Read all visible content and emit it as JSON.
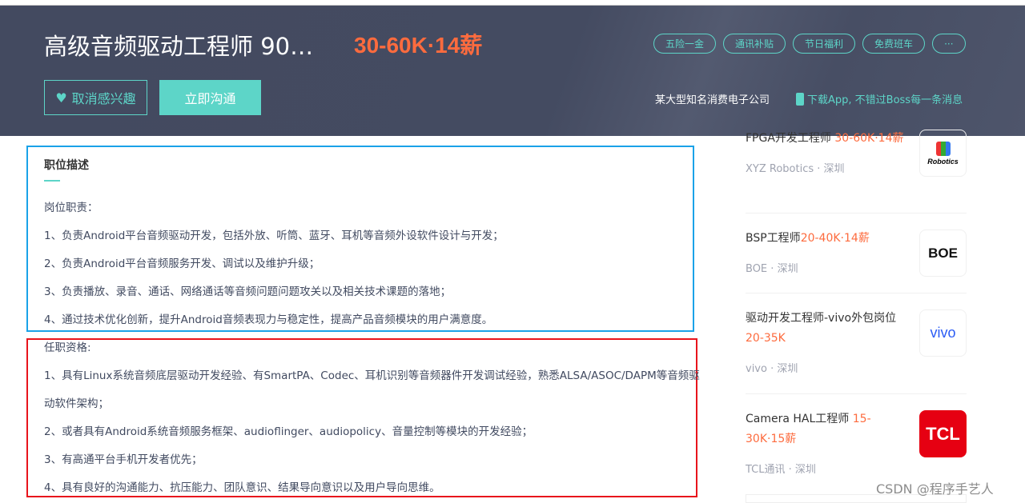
{
  "header": {
    "title": "高级音频驱动工程师 90…",
    "salary": "30-60K·14薪",
    "interest_button": "取消感兴趣",
    "chat_button": "立即沟通",
    "tags": [
      "五险一金",
      "通讯补贴",
      "节日福利",
      "免费班车",
      "···"
    ],
    "company": "某大型知名消费电子公司",
    "app_promo": "下载App, 不错过Boss每一条消息"
  },
  "description": {
    "section_title": "职位描述",
    "lines": [
      "岗位职责：",
      "1、负责Android平台音频驱动开发，包括外放、听筒、蓝牙、耳机等音频外设软件设计与开发；",
      "2、负责Android平台音频服务开发、调试以及维护升级；",
      "3、负责播放、录音、通话、网络通话等音频问题问题攻关以及相关技术课题的落地；",
      "4、通过技术优化创新，提升Android音频表现力与稳定性，提高产品音频模块的用户满意度。",
      "任职资格:",
      "1、具有Linux系统音频底层驱动开发经验、有SmartPA、Codec、耳机识别等音频器件开发调试经验，熟悉ALSA/ASOC/DAPM等音频驱",
      "动软件架构；",
      "2、或者具有Android系统音频服务框架、audioflinger、audiopolicy、音量控制等模块的开发经验；",
      "3、有高通平台手机开发者优先；",
      "4、具有良好的沟通能力、抗压能力、团队意识、结果导向意识以及用户导向思维。"
    ]
  },
  "sidebar": {
    "jobs": [
      {
        "title": "FPGA开发工程师",
        "pay": "30-60K·14薪",
        "company": "XYZ Robotics",
        "city": "深圳",
        "logo": "Robotics"
      },
      {
        "title": "BSP工程师",
        "pay": "20-40K·14薪",
        "company": "BOE",
        "city": "深圳",
        "logo": "BOE"
      },
      {
        "title": "驱动开发工程师-vivo外包岗位",
        "pay": "20-35K",
        "company": "vivo",
        "city": "深圳",
        "logo": "vivo"
      },
      {
        "title": "Camera HAL工程师",
        "pay": "15-30K·15薪",
        "company": "TCL通讯",
        "city": "深圳",
        "logo": "TCL"
      }
    ],
    "separator": "·"
  },
  "watermark": "CSDN @程序手艺人",
  "colors": {
    "accent": "#5dd5c8",
    "salary": "#fd6b3e",
    "header_bg": "#444b61"
  }
}
